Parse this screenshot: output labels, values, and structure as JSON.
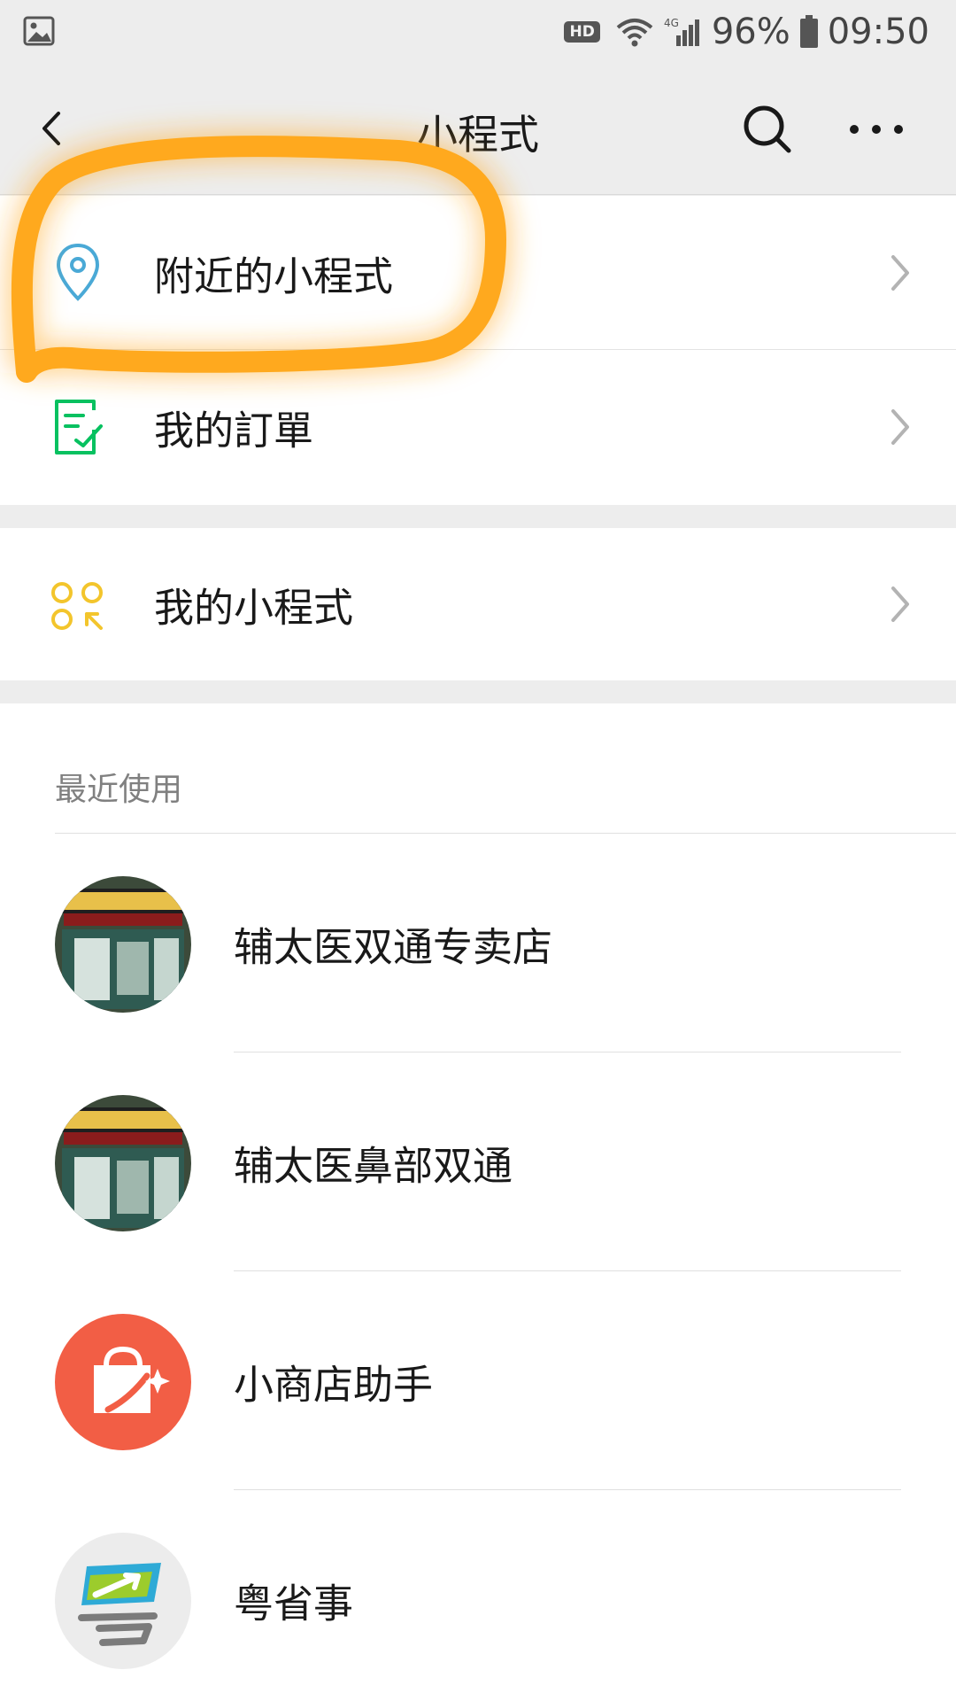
{
  "status_bar": {
    "hd_badge": "HD",
    "battery": "96%",
    "time": "09:50"
  },
  "header": {
    "title": "小程式"
  },
  "menu": {
    "group1": [
      {
        "label": "附近的小程式",
        "icon": "location-pin-icon"
      },
      {
        "label": "我的訂單",
        "icon": "order-checklist-icon"
      }
    ],
    "group2": [
      {
        "label": "我的小程式",
        "icon": "my-miniprograms-icon"
      }
    ]
  },
  "recent": {
    "header": "最近使用",
    "items": [
      {
        "name": "辅太医双通专卖店",
        "avatar": "store-photo-avatar"
      },
      {
        "name": "辅太医鼻部双通",
        "avatar": "store-photo-avatar"
      },
      {
        "name": "小商店助手",
        "avatar": "shopping-bag-avatar"
      },
      {
        "name": "粤省事",
        "avatar": "yue-logo-avatar"
      }
    ]
  },
  "colors": {
    "accent_green": "#07c160",
    "pin_blue": "#4aa9d6",
    "icon_yellow": "#f3c52c",
    "highlight_orange": "#ffa91e",
    "shop_red": "#f25e45"
  }
}
